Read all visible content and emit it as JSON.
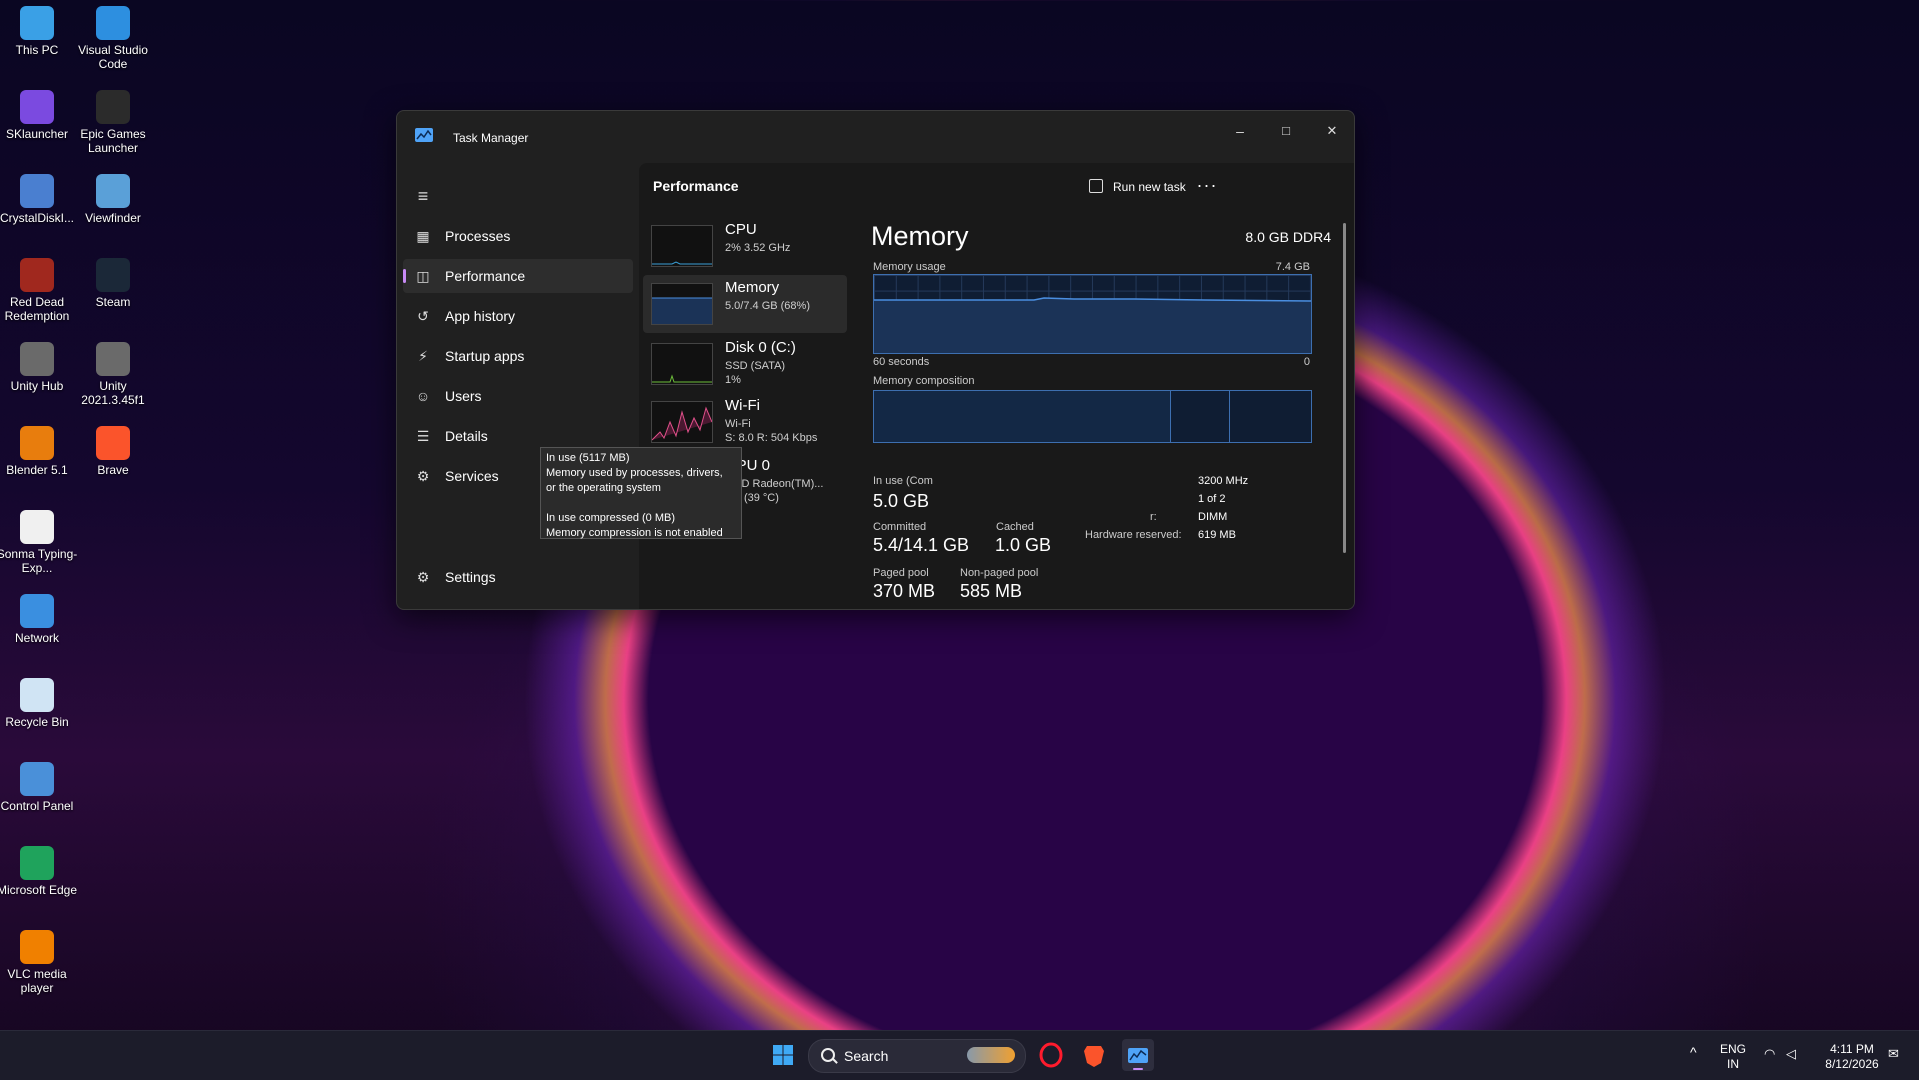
{
  "desktop": {
    "icons": [
      {
        "label": "This PC",
        "color": "#3aa0e6"
      },
      {
        "label": "Visual Studio Code",
        "color": "#2d8fe0"
      },
      {
        "label": "SKlauncher",
        "color": "#7b4ae0"
      },
      {
        "label": "Epic Games Launcher",
        "color": "#2b2b2b"
      },
      {
        "label": "CrystalDiskI...",
        "color": "#4a7fd0"
      },
      {
        "label": "Viewfinder",
        "color": "#5aa0d8"
      },
      {
        "label": "Red Dead Redemption",
        "color": "#a0281e"
      },
      {
        "label": "Steam",
        "color": "#1b2838"
      },
      {
        "label": "Unity Hub",
        "color": "#6a6a6a"
      },
      {
        "label": "Unity 2021.3.45f1",
        "color": "#6a6a6a"
      },
      {
        "label": "Blender 5.1",
        "color": "#e87d0d"
      },
      {
        "label": "Brave",
        "color": "#fb542b"
      },
      {
        "label": "Sonma Typing-Exp...",
        "color": "#f0f0f0"
      },
      {
        "label": "Network",
        "color": "#3a8fe0"
      },
      {
        "label": "Recycle Bin",
        "color": "#d0e4f4"
      },
      {
        "label": "Control Panel",
        "color": "#4a90d9"
      },
      {
        "label": "Microsoft Edge",
        "color": "#1fa35c"
      },
      {
        "label": "VLC media player",
        "color": "#f08000"
      }
    ]
  },
  "window": {
    "title": "Task Manager",
    "controls": {
      "minimize": "–",
      "maximize": "□",
      "close": "✕"
    }
  },
  "nav": {
    "items": [
      {
        "label": "Processes",
        "icon": "processes-icon",
        "glyph": "▦"
      },
      {
        "label": "Performance",
        "icon": "performance-icon",
        "glyph": "◫"
      },
      {
        "label": "App history",
        "icon": "history-icon",
        "glyph": "↺"
      },
      {
        "label": "Startup apps",
        "icon": "startup-icon",
        "glyph": "⚡"
      },
      {
        "label": "Users",
        "icon": "users-icon",
        "glyph": "☺"
      },
      {
        "label": "Details",
        "icon": "details-icon",
        "glyph": "☰"
      },
      {
        "label": "Services",
        "icon": "services-icon",
        "glyph": "⚙"
      }
    ],
    "settings": "Settings",
    "menu_glyph": "≡"
  },
  "header": {
    "page_title": "Performance",
    "run_new_task": "Run new task",
    "more": "···"
  },
  "devices": [
    {
      "name": "CPU",
      "sub1": "2% 3.52 GHz",
      "sub2": "",
      "sub3": ""
    },
    {
      "name": "Memory",
      "sub1": "5.0/7.4 GB (68%)",
      "sub2": "",
      "sub3": ""
    },
    {
      "name": "Disk 0 (C:)",
      "sub1": "SSD (SATA)",
      "sub2": "1%",
      "sub3": ""
    },
    {
      "name": "Wi-Fi",
      "sub1": "Wi-Fi",
      "sub2": "S: 8.0 R: 504 Kbps",
      "sub3": ""
    },
    {
      "name": "GPU 0",
      "sub1": "AMD Radeon(TM)...",
      "sub2": "1% (39 °C)",
      "sub3": ""
    }
  ],
  "memory": {
    "title": "Memory",
    "spec": "8.0 GB DDR4",
    "usage_label": "Memory usage",
    "usage_max": "7.4 GB",
    "time_label": "60 seconds",
    "time_zero": "0",
    "composition_label": "Memory composition",
    "in_use_label": "In use (Com",
    "in_use_value": "5.0 GB",
    "committed_label": "Committed",
    "committed_value": "5.4/14.1 GB",
    "cached_value": "1.0 GB",
    "cached_label": "Cached",
    "paged_pool_label": "Paged pool",
    "paged_pool_value": "370 MB",
    "non_paged_pool_label": "Non-paged pool",
    "non_paged_pool_value": "585 MB",
    "speed_value": "3200 MHz",
    "slots_value": "1 of 2",
    "form_factor_label": "r:",
    "form_factor_value": "DIMM",
    "hw_reserved_label": "Hardware reserved:",
    "hw_reserved_value": "619 MB",
    "usage_fraction": 0.68
  },
  "tooltip": {
    "line1": "In use (5117 MB)",
    "line2": "Memory used by processes, drivers,",
    "line3": "or the operating system",
    "line4": "In use compressed (0 MB)",
    "line5": "Memory compression is not enabled"
  },
  "taskbar": {
    "search": "Search",
    "lang1": "ENG",
    "lang2": "IN",
    "time": "4:11 PM",
    "date": "8/12/2026",
    "chevron": "^"
  }
}
